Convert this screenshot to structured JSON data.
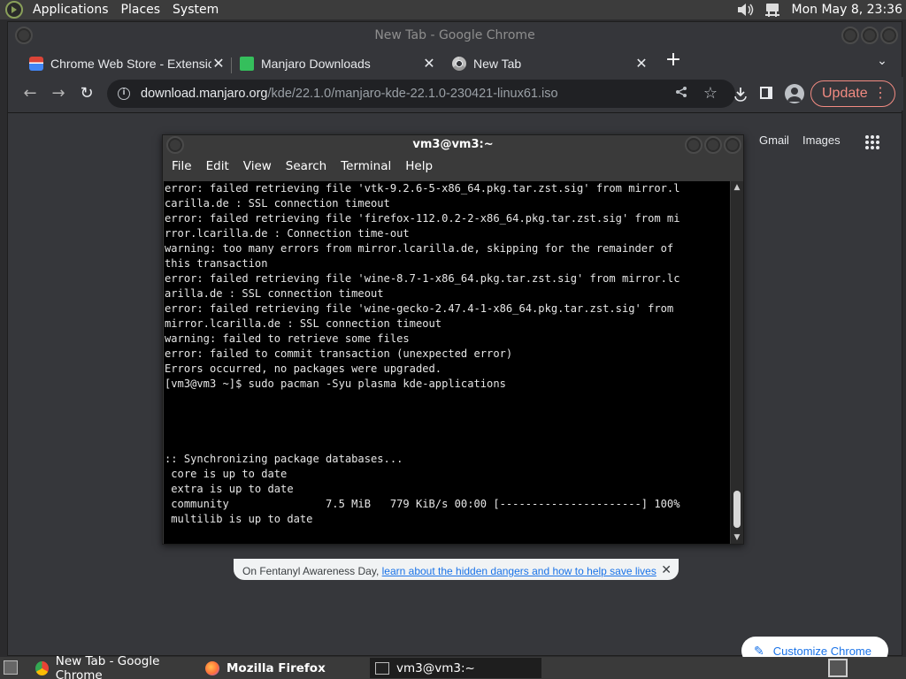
{
  "top_panel": {
    "menus": [
      "Applications",
      "Places",
      "System"
    ],
    "clock": "Mon May  8, 23:36",
    "icons": [
      "manjaro-logo-icon",
      "volume-icon",
      "network-icon"
    ]
  },
  "chrome": {
    "window_title": "New Tab - Google Chrome",
    "tabs": [
      {
        "label": "Chrome Web Store - Extensio",
        "icon": "webstore-icon"
      },
      {
        "label": "Manjaro Downloads",
        "icon": "manjaro-icon"
      },
      {
        "label": "New Tab",
        "icon": "chrome-icon"
      }
    ],
    "new_tab": "+",
    "tab_search": "⌄",
    "url_host": "download.manjaro.org",
    "url_path": "/kde/22.1.0/manjaro-kde-22.1.0-230421-linux61.iso",
    "update_label": "Update",
    "nav": {
      "back": "←",
      "forward": "→",
      "reload": "↻"
    }
  },
  "newtab": {
    "gmail": "Gmail",
    "images": "Images",
    "notice_prefix": "On Fentanyl Awareness Day, ",
    "notice_link": "learn about the hidden dangers and how to help save lives",
    "customize": "Customize Chrome"
  },
  "terminal": {
    "title": "vm3@vm3:~",
    "menus": [
      "File",
      "Edit",
      "View",
      "Search",
      "Terminal",
      "Help"
    ],
    "lines": [
      "error: failed retrieving file 'vtk-9.2.6-5-x86_64.pkg.tar.zst.sig' from mirror.l",
      "carilla.de : SSL connection timeout",
      "error: failed retrieving file 'firefox-112.0.2-2-x86_64.pkg.tar.zst.sig' from mi",
      "rror.lcarilla.de : Connection time-out",
      "warning: too many errors from mirror.lcarilla.de, skipping for the remainder of",
      "this transaction",
      "error: failed retrieving file 'wine-8.7-1-x86_64.pkg.tar.zst.sig' from mirror.lc",
      "arilla.de : SSL connection timeout",
      "error: failed retrieving file 'wine-gecko-2.47.4-1-x86_64.pkg.tar.zst.sig' from",
      "mirror.lcarilla.de : SSL connection timeout",
      "warning: failed to retrieve some files",
      "error: failed to commit transaction (unexpected error)",
      "Errors occurred, no packages were upgraded.",
      "[vm3@vm3 ~]$ sudo pacman -Syu plasma kde-applications",
      "",
      "",
      "",
      "",
      ":: Synchronizing package databases...",
      " core is up to date",
      " extra is up to date",
      " community               7.5 MiB   779 KiB/s 00:00 [----------------------] 100%",
      " multilib is up to date"
    ]
  },
  "taskbar": {
    "items": [
      {
        "label": "New Tab - Google Chrome",
        "icon": "chrome-icon",
        "bold": false
      },
      {
        "label": "Mozilla Firefox",
        "icon": "firefox-icon",
        "bold": true
      },
      {
        "label": "vm3@vm3:~",
        "icon": "terminal-icon",
        "bold": false
      }
    ]
  }
}
